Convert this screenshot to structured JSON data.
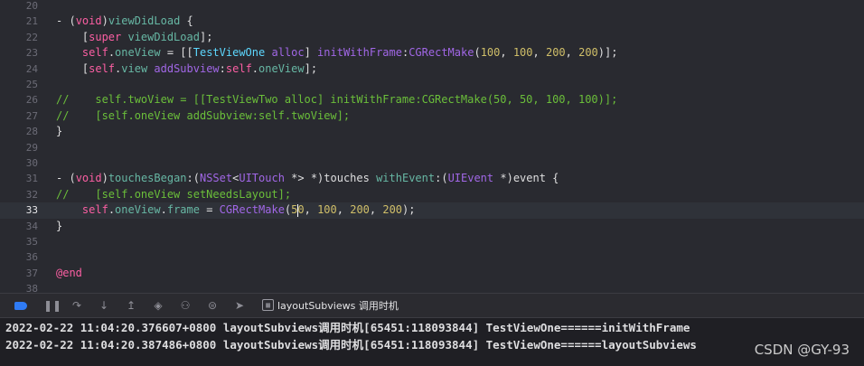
{
  "editor": {
    "lines": [
      {
        "n": "20",
        "tokens": []
      },
      {
        "n": "21",
        "tokens": [
          [
            "cm",
            "- ("
          ],
          [
            "k",
            "void"
          ],
          [
            "cm",
            ")"
          ],
          [
            "f",
            "viewDidLoad"
          ],
          [
            "cm",
            " {"
          ]
        ]
      },
      {
        "n": "22",
        "tokens": [
          [
            "cm",
            "    ["
          ],
          [
            "k",
            "super"
          ],
          [
            "cm",
            " "
          ],
          [
            "f",
            "viewDidLoad"
          ],
          [
            "cm",
            "];"
          ]
        ]
      },
      {
        "n": "23",
        "tokens": [
          [
            "cm",
            "    "
          ],
          [
            "k",
            "self"
          ],
          [
            "cm",
            "."
          ],
          [
            "f",
            "oneView"
          ],
          [
            "cm",
            " = [["
          ],
          [
            "t",
            "TestViewOne"
          ],
          [
            "cm",
            " "
          ],
          [
            "p",
            "alloc"
          ],
          [
            "cm",
            "] "
          ],
          [
            "p",
            "initWithFrame"
          ],
          [
            "cm",
            ":"
          ],
          [
            "p",
            "CGRectMake"
          ],
          [
            "cm",
            "("
          ],
          [
            "n",
            "100"
          ],
          [
            "cm",
            ", "
          ],
          [
            "n",
            "100"
          ],
          [
            "cm",
            ", "
          ],
          [
            "n",
            "200"
          ],
          [
            "cm",
            ", "
          ],
          [
            "n",
            "200"
          ],
          [
            "cm",
            ")];"
          ]
        ]
      },
      {
        "n": "24",
        "tokens": [
          [
            "cm",
            "    ["
          ],
          [
            "k",
            "self"
          ],
          [
            "cm",
            "."
          ],
          [
            "f",
            "view"
          ],
          [
            "cm",
            " "
          ],
          [
            "p",
            "addSubview"
          ],
          [
            "cm",
            ":"
          ],
          [
            "k",
            "self"
          ],
          [
            "cm",
            "."
          ],
          [
            "f",
            "oneView"
          ],
          [
            "cm",
            "];"
          ]
        ]
      },
      {
        "n": "25",
        "tokens": []
      },
      {
        "n": "26",
        "tokens": [
          [
            "c",
            "//    self.twoView = [[TestViewTwo alloc] initWithFrame:CGRectMake(50, 50, 100, 100)];"
          ]
        ]
      },
      {
        "n": "27",
        "tokens": [
          [
            "c",
            "//    [self.oneView addSubview:self.twoView];"
          ]
        ]
      },
      {
        "n": "28",
        "tokens": [
          [
            "cm",
            "}"
          ]
        ]
      },
      {
        "n": "29",
        "tokens": []
      },
      {
        "n": "30",
        "tokens": []
      },
      {
        "n": "31",
        "tokens": [
          [
            "cm",
            "- ("
          ],
          [
            "k",
            "void"
          ],
          [
            "cm",
            ")"
          ],
          [
            "f",
            "touchesBegan"
          ],
          [
            "cm",
            ":("
          ],
          [
            "p",
            "NSSet"
          ],
          [
            "cm",
            "<"
          ],
          [
            "p",
            "UITouch"
          ],
          [
            "cm",
            " *> *)touches "
          ],
          [
            "f",
            "withEvent"
          ],
          [
            "cm",
            ":("
          ],
          [
            "p",
            "UIEvent"
          ],
          [
            "cm",
            " *)event {"
          ]
        ]
      },
      {
        "n": "32",
        "tokens": [
          [
            "c",
            "//    [self.oneView setNeedsLayout];"
          ]
        ]
      },
      {
        "n": "33",
        "current": true,
        "tokens": [
          [
            "cm",
            "    "
          ],
          [
            "k",
            "self"
          ],
          [
            "cm",
            "."
          ],
          [
            "f",
            "oneView"
          ],
          [
            "cm",
            "."
          ],
          [
            "f",
            "frame"
          ],
          [
            "cm",
            " = "
          ],
          [
            "p",
            "CGRectMake"
          ],
          [
            "cm",
            "("
          ],
          [
            "n",
            "5"
          ],
          [
            "caret",
            ""
          ],
          [
            "n",
            "0"
          ],
          [
            "cm",
            ", "
          ],
          [
            "n",
            "100"
          ],
          [
            "cm",
            ", "
          ],
          [
            "n",
            "200"
          ],
          [
            "cm",
            ", "
          ],
          [
            "n",
            "200"
          ],
          [
            "cm",
            ");"
          ]
        ]
      },
      {
        "n": "34",
        "tokens": [
          [
            "cm",
            "}"
          ]
        ]
      },
      {
        "n": "35",
        "tokens": []
      },
      {
        "n": "36",
        "tokens": []
      },
      {
        "n": "37",
        "tokens": [
          [
            "k",
            "@end"
          ]
        ]
      },
      {
        "n": "38",
        "tokens": []
      }
    ]
  },
  "debugbar": {
    "frame_label": "layoutSubviews 调用时机",
    "icons": [
      "breakpoints-toggle-icon",
      "pause-icon",
      "step-over-icon",
      "step-into-icon",
      "step-out-icon",
      "view-hierarchy-icon",
      "memory-graph-icon",
      "environment-overrides-icon",
      "simulate-location-icon"
    ]
  },
  "console": {
    "lines": [
      "2022-02-22 11:04:20.376607+0800 layoutSubviews调用时机[65451:118093844] TestViewOne======initWithFrame",
      "2022-02-22 11:04:20.387486+0800 layoutSubviews调用时机[65451:118093844] TestViewOne======layoutSubviews"
    ]
  },
  "watermark": "CSDN @GY-93",
  "colors": {
    "keyword": "#fc5fa3",
    "function": "#67b7a4",
    "type": "#5dd8ff",
    "method": "#a167e6",
    "number": "#d0bf69",
    "comment": "#6bbf3a"
  }
}
